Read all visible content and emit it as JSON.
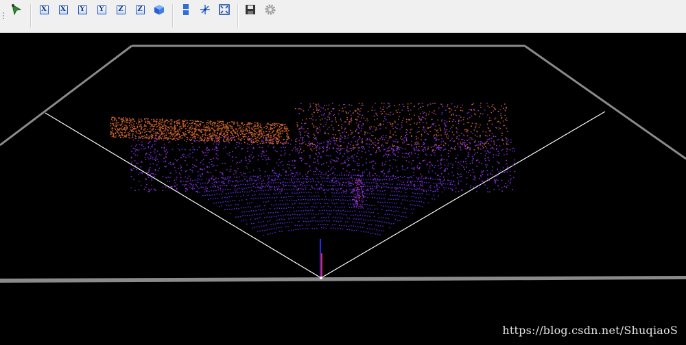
{
  "toolbar": {
    "buttons": [
      {
        "name": "pick-point-icon",
        "glyph": ""
      },
      {
        "name": "view-x-pos-button",
        "glyph": "X"
      },
      {
        "name": "view-x-neg-button",
        "glyph": "X"
      },
      {
        "name": "view-y-pos-button",
        "glyph": "Y"
      },
      {
        "name": "view-y-neg-button",
        "glyph": "Y"
      },
      {
        "name": "view-z-pos-button",
        "glyph": "Z"
      },
      {
        "name": "view-z-neg-button",
        "glyph": "Z"
      },
      {
        "name": "view-iso-cube-icon",
        "glyph": ""
      },
      {
        "name": "split-view-icon",
        "glyph": ""
      },
      {
        "name": "rotation-center-icon",
        "glyph": ""
      },
      {
        "name": "zoom-fit-icon",
        "glyph": ""
      },
      {
        "name": "save-icon",
        "glyph": ""
      },
      {
        "name": "settings-gear-icon",
        "glyph": ""
      }
    ]
  },
  "viewport": {
    "background": "#000000",
    "frame_color": "#8a8a8a",
    "fov_line_color": "#ffffff",
    "point_colors": [
      "#c8602a",
      "#8a33d6",
      "#5a2bd8"
    ]
  },
  "watermark": {
    "text": "https://blog.csdn.net/ShuqiaoS"
  }
}
